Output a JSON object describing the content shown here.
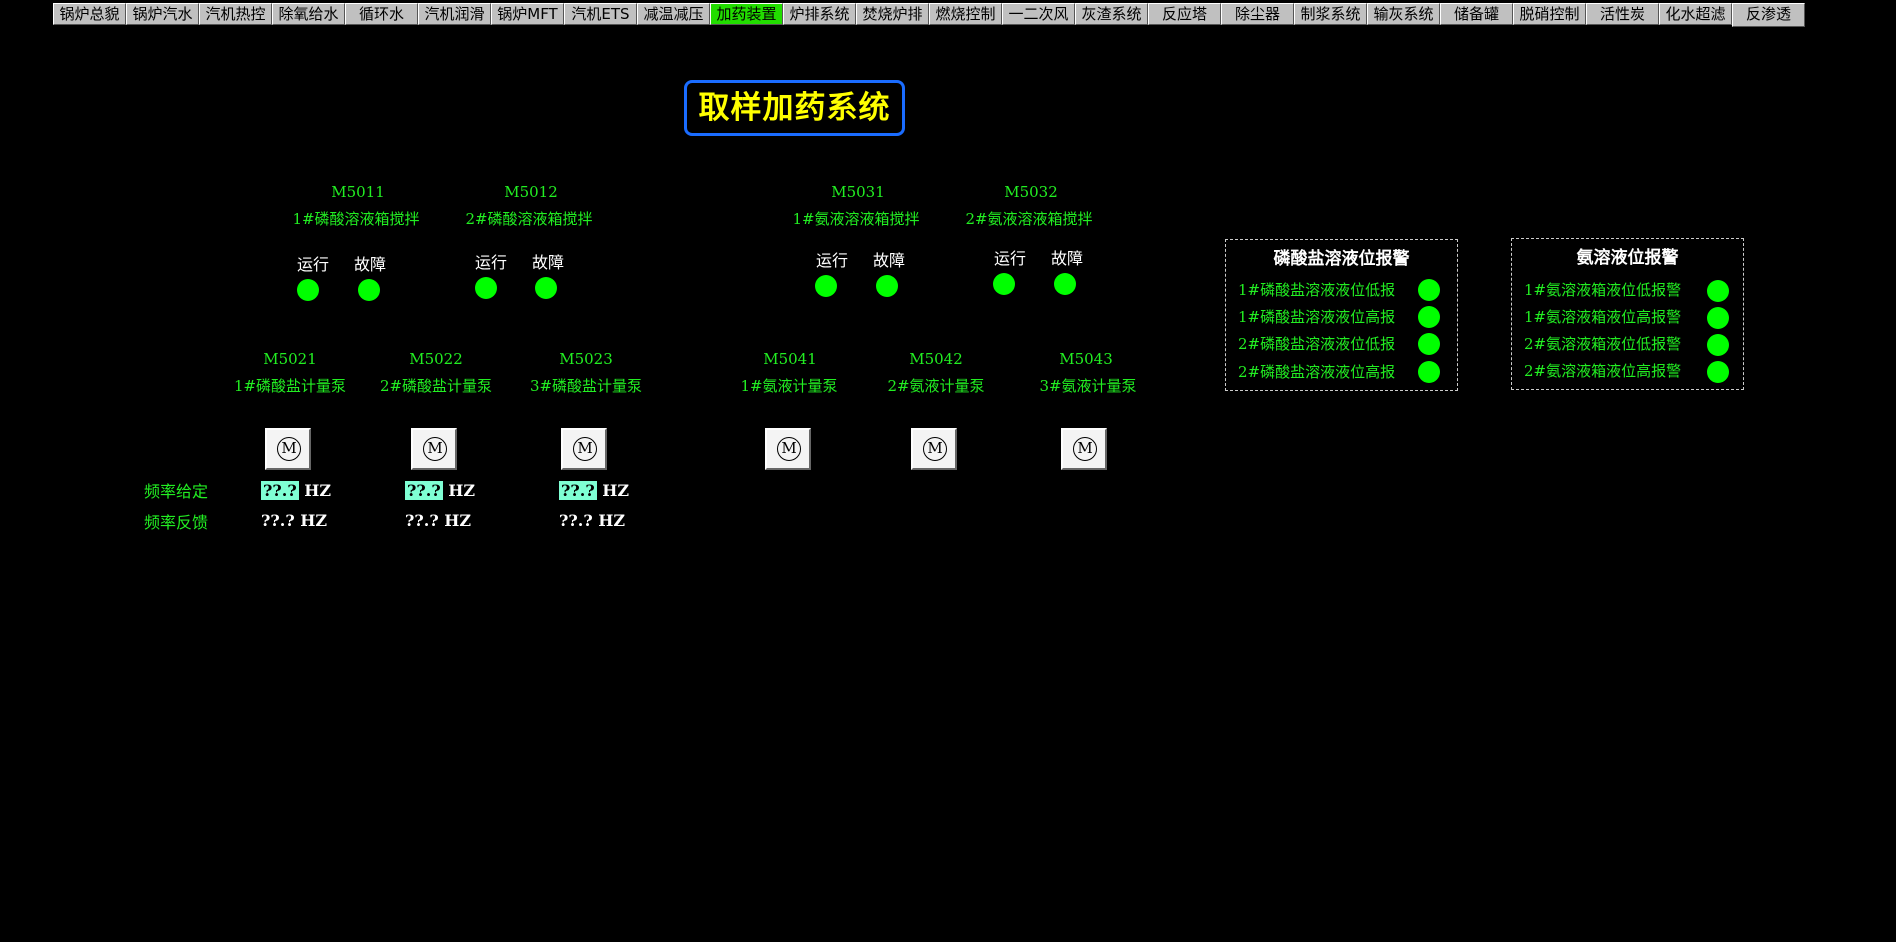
{
  "nav": {
    "tabs": [
      {
        "label": "锅炉总貌"
      },
      {
        "label": "锅炉汽水"
      },
      {
        "label": "汽机热控"
      },
      {
        "label": "除氧给水"
      },
      {
        "label": "循环水"
      },
      {
        "label": "汽机润滑"
      },
      {
        "label": "锅炉MFT"
      },
      {
        "label": "汽机ETS"
      },
      {
        "label": "减温减压"
      },
      {
        "label": "加药装置"
      },
      {
        "label": "炉排系统"
      },
      {
        "label": "焚烧炉排"
      },
      {
        "label": "燃烧控制"
      },
      {
        "label": "一二次风"
      },
      {
        "label": "灰渣系统"
      },
      {
        "label": "反应塔"
      },
      {
        "label": "除尘器"
      },
      {
        "label": "制浆系统"
      },
      {
        "label": "输灰系统"
      },
      {
        "label": "储备罐"
      },
      {
        "label": "脱硝控制"
      },
      {
        "label": "活性炭"
      },
      {
        "label": "化水超滤"
      },
      {
        "label": "反渗透"
      }
    ],
    "active_index": 9,
    "active_color": "#22dd00"
  },
  "title": "取样加药系统",
  "status_labels": {
    "run": "运行",
    "fault": "故障"
  },
  "mixers": [
    {
      "tag": "M5011",
      "name": "1#磷酸溶液箱搅拌"
    },
    {
      "tag": "M5012",
      "name": "2#磷酸溶液箱搅拌"
    },
    {
      "tag": "M5031",
      "name": "1#氨液溶液箱搅拌"
    },
    {
      "tag": "M5032",
      "name": "2#氨液溶液箱搅拌"
    }
  ],
  "pumps": [
    {
      "tag": "M5021",
      "name": "1#磷酸盐计量泵",
      "motor": "M",
      "freq_set": "??.?",
      "freq_fb": "??.?"
    },
    {
      "tag": "M5022",
      "name": "2#磷酸盐计量泵",
      "motor": "M",
      "freq_set": "??.?",
      "freq_fb": "??.?"
    },
    {
      "tag": "M5023",
      "name": "3#磷酸盐计量泵",
      "motor": "M",
      "freq_set": "??.?",
      "freq_fb": "??.?"
    },
    {
      "tag": "M5041",
      "name": "1#氨液计量泵",
      "motor": "M"
    },
    {
      "tag": "M5042",
      "name": "2#氨液计量泵",
      "motor": "M"
    },
    {
      "tag": "M5043",
      "name": "3#氨液计量泵",
      "motor": "M"
    }
  ],
  "freq_labels": {
    "set": "频率给定",
    "feedback": "频率反馈",
    "unit": "HZ"
  },
  "alarm_panels": [
    {
      "title": "磷酸盐溶液位报警",
      "items": [
        "1#磷酸盐溶液液位低报",
        "1#磷酸盐溶液液位高报",
        "2#磷酸盐溶液液位低报",
        "2#磷酸盐溶液液位高报"
      ]
    },
    {
      "title": "氨溶液位报警",
      "items": [
        "1#氨溶液箱液位低报警",
        "1#氨溶液箱液位高报警",
        "2#氨溶液箱液位低报警",
        "2#氨溶液箱液位高报警"
      ]
    }
  ],
  "colors": {
    "led_on": "#00ff00",
    "label_green": "#22ee22",
    "title_yellow": "#ffff00",
    "title_border": "#1a6cff",
    "freq_input_bg": "#7fffd4"
  }
}
